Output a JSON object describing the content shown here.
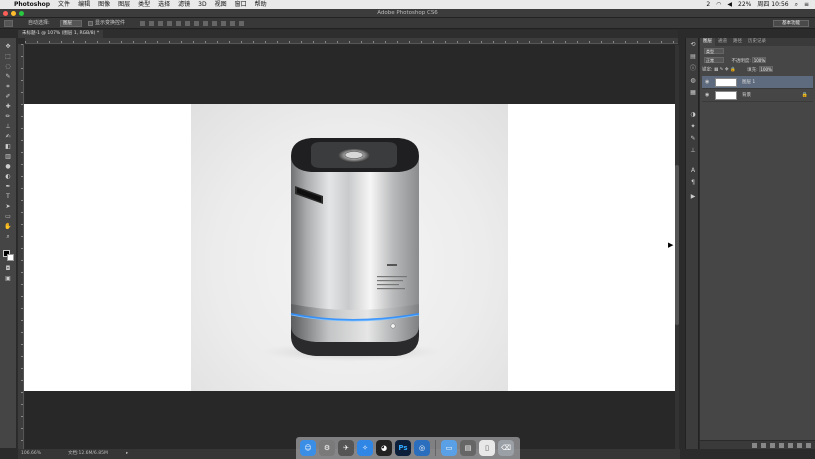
{
  "menubar": {
    "app_name": "Photoshop",
    "menus": [
      "文件",
      "编辑",
      "图像",
      "图层",
      "类型",
      "选择",
      "滤镜",
      "3D",
      "视图",
      "窗口",
      "帮助"
    ],
    "notif_count": "2",
    "battery": "22%",
    "clock": "周四 10:56"
  },
  "window": {
    "title": "Adobe Photoshop CS6"
  },
  "options_bar": {
    "auto_select_label": "自动选择:",
    "auto_select_value": "图层",
    "transform_label": "显示变换控件",
    "workspace": "基本功能"
  },
  "document": {
    "tab_label": "未标题-1 @ 107% (图层 1, RGB/8) *"
  },
  "status": {
    "zoom": "106.66%",
    "doc_size": "文档:12.6M/6.85M",
    "arrow": "▸"
  },
  "layers_panel": {
    "tabs": [
      "图层",
      "通道",
      "路径",
      "历史记录"
    ],
    "filter_label": "类型",
    "blend_mode": "正常",
    "opacity_label": "不透明度:",
    "opacity_value": "100%",
    "lock_label": "锁定:",
    "fill_label": "填充:",
    "fill_value": "100%",
    "layers": [
      {
        "name": "图层 1",
        "selected": true
      },
      {
        "name": "背景",
        "selected": false,
        "locked": true
      }
    ]
  },
  "dock": {
    "apps": [
      {
        "name": "finder-icon",
        "color": "#3a8ee6"
      },
      {
        "name": "system-preferences-icon",
        "color": "#7a7a7a"
      },
      {
        "name": "launchpad-icon",
        "color": "#555555"
      },
      {
        "name": "safari-icon",
        "color": "#2f86e5"
      },
      {
        "name": "qq-icon",
        "color": "#222222"
      },
      {
        "name": "photoshop-icon",
        "color": "#0b1f3a",
        "label": "Ps"
      },
      {
        "name": "browser-icon",
        "color": "#2a6ebd"
      },
      {
        "name": "folder-icon",
        "color": "#5aa0e6"
      },
      {
        "name": "preview-icon",
        "color": "#666666"
      },
      {
        "name": "document-icon",
        "color": "#e8e8e8"
      },
      {
        "name": "trash-icon",
        "color": "#9aa0a6"
      }
    ]
  },
  "colors": {
    "accent_glow": "#2f8fff",
    "selected_layer": "#5e6b7f"
  }
}
